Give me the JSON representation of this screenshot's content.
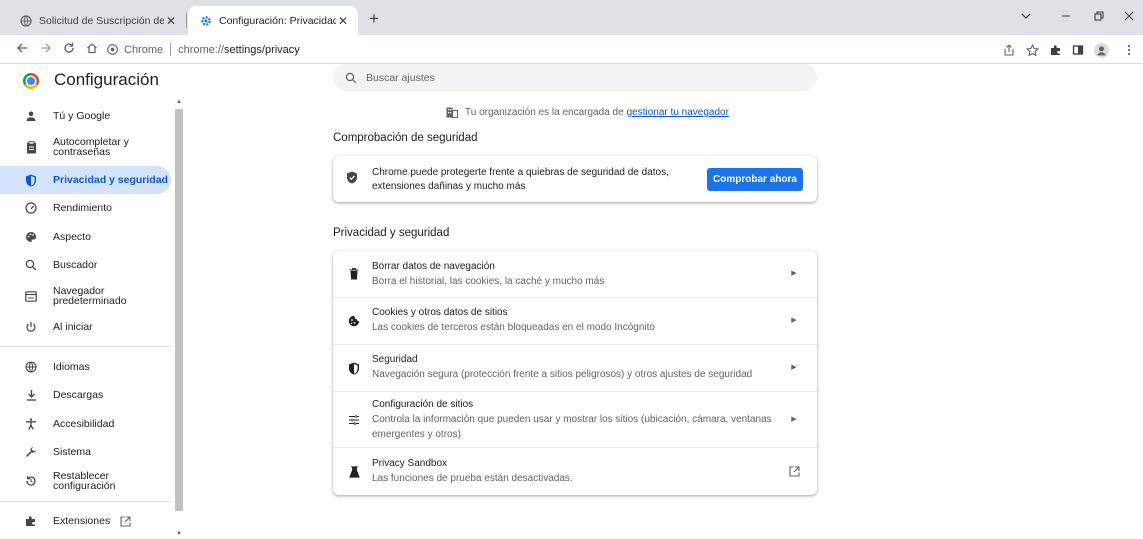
{
  "browser": {
    "tabs": [
      {
        "title": "Solicitud de Suscripción de Deud",
        "active": false
      },
      {
        "title": "Configuración: Privacidad y segu",
        "active": true
      }
    ],
    "new_tab": "+",
    "url_chip": "Chrome",
    "url_scheme": "chrome://",
    "url_path": "settings/privacy",
    "window_controls": [
      "chevron-down-icon",
      "minimize-icon",
      "restore-icon",
      "close-icon"
    ]
  },
  "settings": {
    "title": "Configuración",
    "search_placeholder": "Buscar ajustes"
  },
  "sidebar": {
    "items": [
      {
        "label": "Tú y Google",
        "icon": "person-icon"
      },
      {
        "label": "Autocompletar y",
        "label2": "contraseñas",
        "icon": "clipboard-icon"
      },
      {
        "label": "Privacidad y seguridad",
        "icon": "shield-icon",
        "selected": true
      },
      {
        "label": "Rendimiento",
        "icon": "speedometer-icon"
      },
      {
        "label": "Aspecto",
        "icon": "palette-icon"
      },
      {
        "label": "Buscador",
        "icon": "search-icon"
      },
      {
        "label": "Navegador",
        "label2": "predeterminado",
        "icon": "browser-icon"
      },
      {
        "label": "Al iniciar",
        "icon": "power-icon"
      },
      {
        "label": "Idiomas",
        "icon": "globe-icon"
      },
      {
        "label": "Descargas",
        "icon": "download-icon"
      },
      {
        "label": "Accesibilidad",
        "icon": "accessibility-icon"
      },
      {
        "label": "Sistema",
        "icon": "wrench-icon"
      },
      {
        "label": "Restablecer configuración",
        "icon": "reset-icon"
      },
      {
        "label": "Extensiones",
        "icon": "puzzle-icon"
      }
    ]
  },
  "main": {
    "org_notice_text": "Tu organización es la encargada de",
    "org_notice_link": "gestionar tu navegador",
    "safety_title": "Comprobación de seguridad",
    "safety_text": "Chrome puede protegerte frente a quiebras de seguridad de datos, extensiones dañinas y mucho más",
    "safety_button": "Comprobar ahora",
    "privacy_title": "Privacidad y seguridad",
    "privacy_rows": [
      {
        "title": "Borrar datos de navegación",
        "subtitle": "Borra el historial, las cookies, la caché y mucho más",
        "icon": "trash-icon"
      },
      {
        "title": "Cookies y otros datos de sitios",
        "subtitle": "Las cookies de terceros están bloqueadas en el modo Incógnito",
        "icon": "cookie-icon"
      },
      {
        "title": "Seguridad",
        "subtitle": "Navegación segura (protección frente a sitios peligrosos) y otros ajustes de seguridad",
        "icon": "security-shield-icon"
      },
      {
        "title": "Configuración de sitios",
        "subtitle": "Controla la información que pueden usar y mostrar los sitios (ubicación, cámara, ventanas emergentes y otros)",
        "icon": "tune-icon"
      },
      {
        "title": "Privacy Sandbox",
        "subtitle": "Las funciones de prueba están desactivadas.",
        "icon": "flask-icon"
      }
    ]
  }
}
